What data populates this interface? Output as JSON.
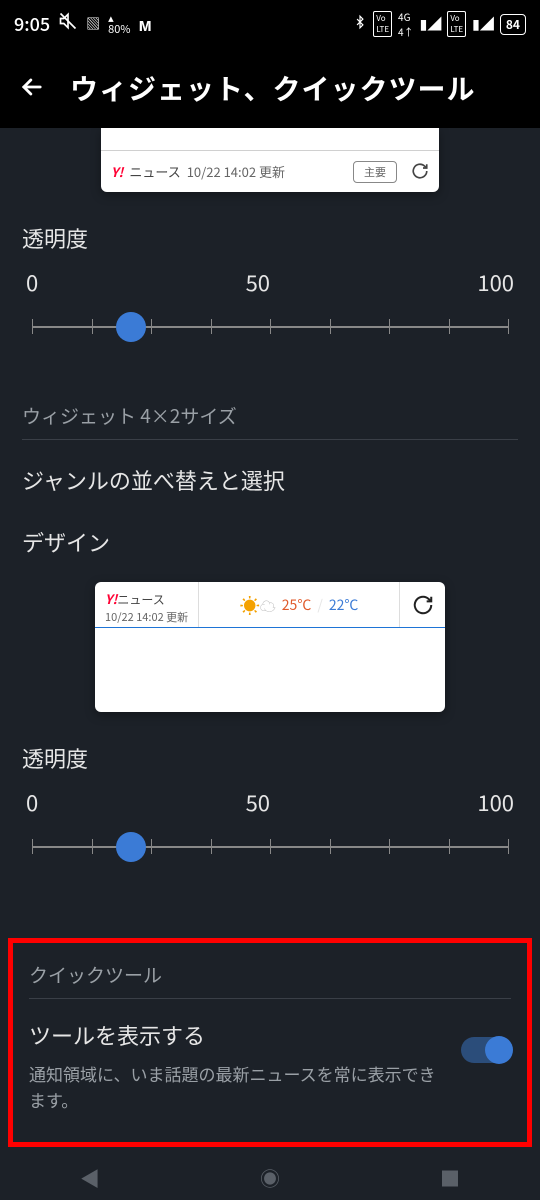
{
  "status": {
    "time": "9:05",
    "battery": "84"
  },
  "header": {
    "title": "ウィジェット、クイックツール"
  },
  "widget1": {
    "brand": "Y!",
    "brand_sub": "ニュース",
    "timestamp": "10/22 14:02 更新",
    "major_label": "主要",
    "opacity_label": "透明度",
    "tick0": "0",
    "tick50": "50",
    "tick100": "100",
    "slider_value": 20
  },
  "section4x2": {
    "heading": "ウィジェット 4×2サイズ",
    "reorder_label": "ジャンルの並べ替えと選択",
    "design_label": "デザイン"
  },
  "widget2": {
    "brand": "Y!",
    "brand_sub": "ニュース",
    "timestamp": "10/22 14:02 更新",
    "temp_hi": "25℃",
    "temp_sep": "/",
    "temp_lo": "22℃",
    "opacity_label": "透明度",
    "tick0": "0",
    "tick50": "50",
    "tick100": "100",
    "slider_value": 20
  },
  "quicktool": {
    "heading": "クイックツール",
    "title": "ツールを表示する",
    "desc": "通知領域に、いま話題の最新ニュースを常に表示できます。",
    "enabled": true
  }
}
